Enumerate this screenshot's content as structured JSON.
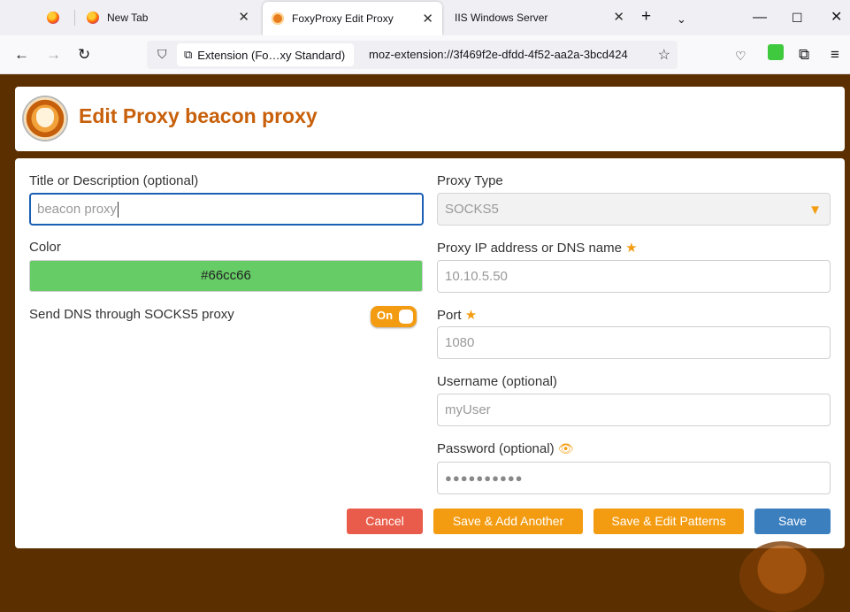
{
  "browser": {
    "tabs": [
      {
        "label": "",
        "icon": "firefox-icon"
      },
      {
        "label": "New Tab",
        "icon": "firefox-icon"
      },
      {
        "label": "FoxyProxy Edit Proxy",
        "icon": "foxyproxy-icon"
      },
      {
        "label": "IIS Windows Server",
        "icon": ""
      }
    ],
    "urlbar": {
      "identity_label": "Extension (Fo…xy Standard)",
      "url": "moz-extension://3f469f2e-dfdd-4f52-aa2a-3bcd424"
    }
  },
  "page": {
    "title": "Edit Proxy beacon proxy",
    "accent_color": "#c8600b"
  },
  "form": {
    "title_label": "Title or Description (optional)",
    "title_value": "beacon proxy",
    "color_label": "Color",
    "color_value": "#66cc66",
    "dns_label": "Send DNS through SOCKS5 proxy",
    "dns_toggle_label": "On",
    "proxy_type_label": "Proxy Type",
    "proxy_type_value": "SOCKS5",
    "ip_label": "Proxy IP address or DNS name",
    "ip_value": "10.10.5.50",
    "port_label": "Port",
    "port_value": "1080",
    "username_label": "Username (optional)",
    "username_value": "myUser",
    "password_label": "Password (optional)",
    "password_value": "●●●●●●●●●●"
  },
  "buttons": {
    "cancel": "Cancel",
    "save_add": "Save & Add Another",
    "save_patterns": "Save & Edit Patterns",
    "save": "Save"
  }
}
